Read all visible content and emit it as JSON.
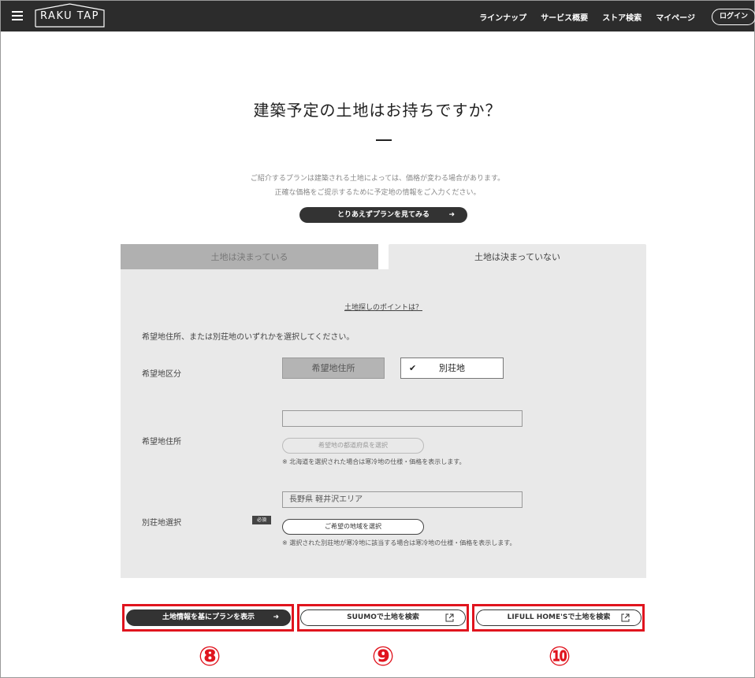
{
  "header": {
    "logo_text": "RAKU TAP",
    "nav": [
      "ラインナップ",
      "サービス概要",
      "ストア検索",
      "マイページ"
    ],
    "login_label": "ログイン"
  },
  "main": {
    "title": "建築予定の土地はお持ちですか？",
    "intro_line1": "ご紹介するプランは建築される土地によっては、価格が変わる場合があります。",
    "intro_line2": "正確な価格をご提示するために予定地の情報をご入力ください。",
    "see_plan_label": "とりあえずプランを見てみる",
    "arrow": "➜"
  },
  "tabs": {
    "decided": "土地は決まっている",
    "undecided": "土地は決まっていない"
  },
  "panel": {
    "tips_link": "土地探しのポイントは？",
    "instruction": "希望地住所、または別荘地のいずれかを選択してください。",
    "label_kubun": "希望地区分",
    "choice_jusho": "希望地住所",
    "choice_bessou": "別荘地",
    "check": "✔",
    "label_jusho": "希望地住所",
    "jusho_value": "",
    "pref_button": "希望地の都道府県を選択",
    "note_hokkaido": "※ 北海道を選択された場合は寒冷地の仕様・価格を表示します。",
    "label_bessou": "別荘地選択",
    "required": "必須",
    "bessou_value": "長野県 軽井沢エリア",
    "area_button": "ご希望の地域を選択",
    "note_cold": "※ 選択された別荘地が寒冷地に該当する場合は寒冷地の仕様・価格を表示します。"
  },
  "bottom": {
    "show_plan_label": "土地情報を基にプランを表示",
    "suumo_label": "SUUMOで土地を検索",
    "lifull_label": "LIFULL HOME'Sで土地を検索",
    "num8": "⑧",
    "num9": "⑨",
    "num10": "⑩"
  },
  "colors": {
    "header_bg": "#2c2c2c",
    "highlight": "#e0141e",
    "panel_bg": "#e9e9e9"
  }
}
